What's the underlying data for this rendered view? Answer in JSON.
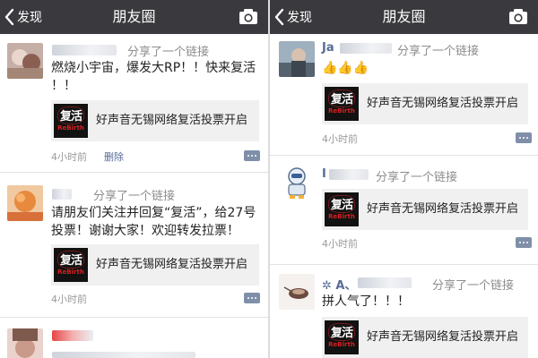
{
  "header": {
    "back_label": "发现",
    "title": "朋友圈"
  },
  "left_feed": {
    "posts": [
      {
        "action": "分享了一个链接",
        "text_lines": [
          "燃烧小宇宙，爆发大RP！！快来复活",
          "！！"
        ],
        "link": {
          "thumb_text": "复活",
          "thumb_sub": "ReBirth",
          "title": "好声音无锡网络复活投票开启"
        },
        "time": "4小时前",
        "delete_label": "删除"
      },
      {
        "action": "分享了一个链接",
        "text_lines": [
          "请朋友们关注并回复“复活”，给27号",
          "投票！谢谢大家！欢迎转发拉票！"
        ],
        "link": {
          "thumb_text": "复活",
          "thumb_sub": "ReBirth",
          "title": "好声音无锡网络复活投票开启"
        },
        "time": "4小时前"
      },
      {
        "action": ""
      }
    ]
  },
  "right_feed": {
    "posts": [
      {
        "author_visible": "Ja",
        "action": "分享了一个链接",
        "text_lines": [
          "👍👍👍"
        ],
        "link": {
          "thumb_text": "复活",
          "thumb_sub": "ReBirth",
          "title": "好声音无锡网络复活投票开启"
        },
        "time": "4小时前"
      },
      {
        "author_visible": "I",
        "action": "分享了一个链接",
        "link": {
          "thumb_text": "复活",
          "thumb_sub": "ReBirth",
          "title": "好声音无锡网络复活投票开启"
        },
        "time": "4小时前"
      },
      {
        "author_visible": "✲ A、",
        "action": "分享了一个链接",
        "text_lines": [
          "拼人气了！！！"
        ],
        "link": {
          "thumb_text": "复活",
          "thumb_sub": "ReBirth",
          "title": "好声音无锡网络复活投票开启"
        }
      }
    ]
  },
  "icons": {
    "back": "chevron-left-icon",
    "camera": "camera-icon",
    "comment": "comment-dots-icon",
    "like": "thumbs-up-icon"
  },
  "colors": {
    "topbar": "#3a3a3e",
    "link_blue": "#576b95",
    "card_bg": "#f0f0f0",
    "comment_icon": "#7f8fa8"
  }
}
